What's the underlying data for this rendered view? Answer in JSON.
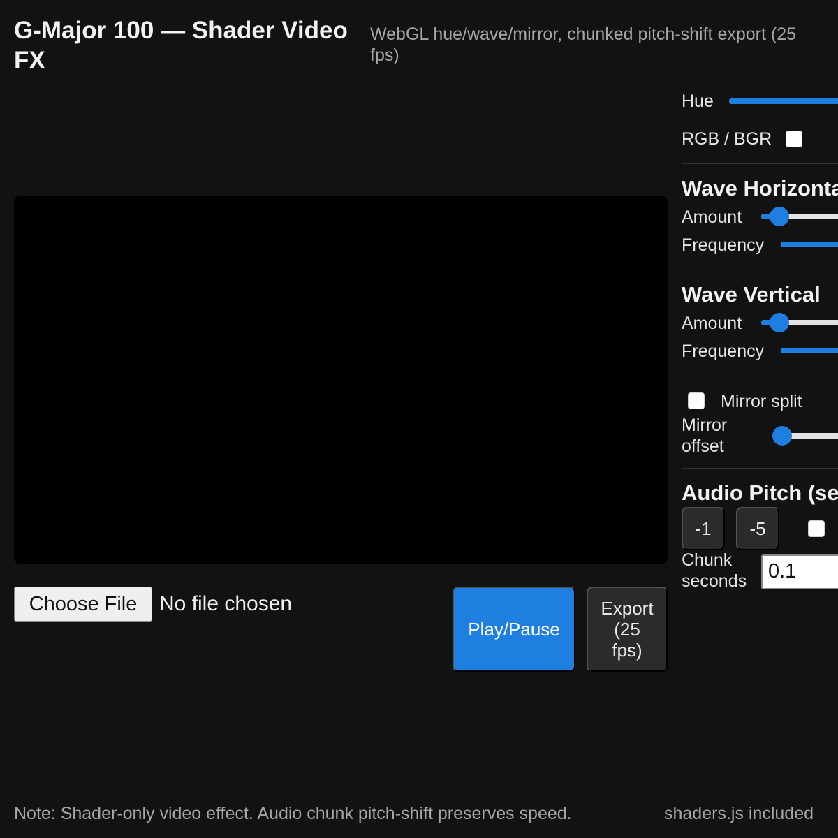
{
  "header": {
    "title": "G-Major 100 — Shader Video FX",
    "subtitle": "WebGL hue/wave/mirror, chunked pitch-shift export (25 fps)"
  },
  "file_input": {
    "button_label": "Choose File",
    "status": "No file chosen"
  },
  "controls": {
    "play_label": "Play/Pause",
    "export_label": "Export (25 fps)"
  },
  "panel": {
    "hue": {
      "label": "Hue",
      "level": 0.9
    },
    "rgb_bgr": {
      "label": "RGB / BGR",
      "checked": false
    },
    "wave_horizontal": {
      "title": "Wave Horizontal",
      "amount": {
        "label": "Amount",
        "level": 0.1
      },
      "frequency": {
        "label": "Frequency",
        "level": 0.45
      }
    },
    "wave_vertical": {
      "title": "Wave Vertical",
      "amount": {
        "label": "Amount",
        "level": 0.1
      },
      "frequency": {
        "label": "Frequency",
        "level": 0.4
      }
    },
    "mirror": {
      "split_label": "Mirror split",
      "split_checked": false,
      "offset_label": "Mirror offset",
      "offset_level": 0.0
    },
    "audio_pitch": {
      "title": "Audio Pitch (semitones)",
      "buttons": [
        "-1",
        "-5"
      ],
      "chunk_label": "Chunk seconds",
      "chunk_value": "0.1"
    }
  },
  "footer": {
    "note": "Note: Shader-only video effect. Audio chunk pitch-shift preserves speed.",
    "credit": "shaders.js included"
  },
  "colors": {
    "background": "#121212",
    "accent": "#1e7fe0",
    "button_dark": "#2b2b2b"
  }
}
